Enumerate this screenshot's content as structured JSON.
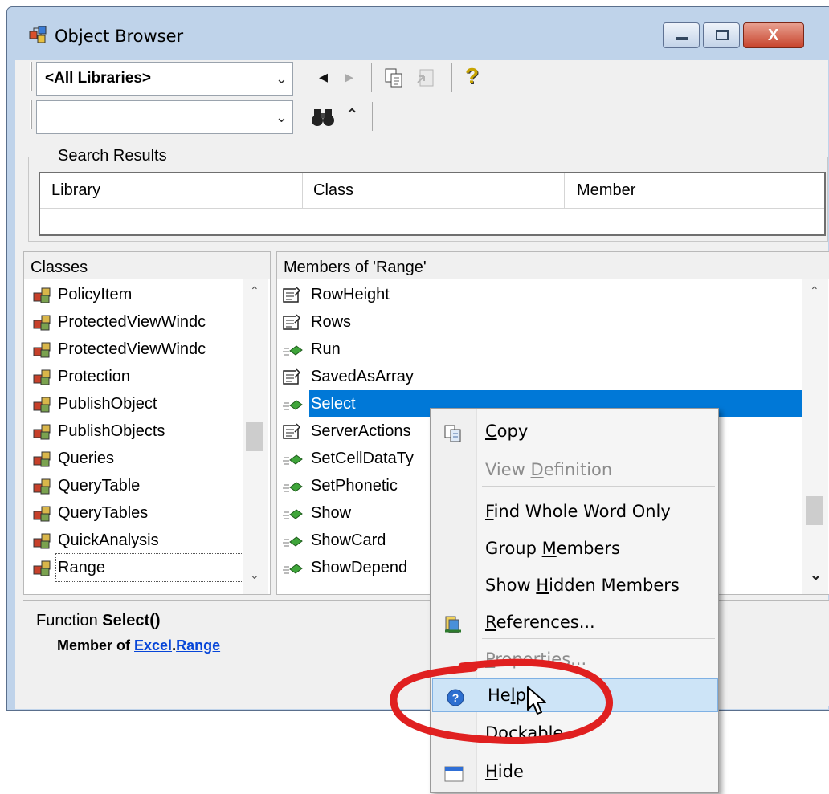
{
  "window": {
    "title": "Object Browser",
    "minimize_label": "–",
    "maximize_label": "□",
    "close_label": "X"
  },
  "toolbar": {
    "library_combo": "<All Libraries>",
    "search_combo": "",
    "back_icon": "◂",
    "forward_icon": "▸",
    "copy_icon": "copy-icon",
    "view_def_icon": "view-definition-icon",
    "help_glyph": "?",
    "search_icon": "binoculars-icon",
    "toggle_glyph": "⌃"
  },
  "search_results": {
    "group_label": "Search Results",
    "columns": [
      "Library",
      "Class",
      "Member"
    ]
  },
  "classes": {
    "header": "Classes",
    "items": [
      "PolicyItem",
      "ProtectedViewWindc",
      "ProtectedViewWindc",
      "Protection",
      "PublishObject",
      "PublishObjects",
      "Queries",
      "QueryTable",
      "QueryTables",
      "QuickAnalysis",
      "Range"
    ]
  },
  "members": {
    "header": "Members of 'Range'",
    "items": [
      {
        "label": "RowHeight",
        "kind": "property"
      },
      {
        "label": "Rows",
        "kind": "property"
      },
      {
        "label": "Run",
        "kind": "method"
      },
      {
        "label": "SavedAsArray",
        "kind": "property"
      },
      {
        "label": "Select",
        "kind": "method",
        "selected": true
      },
      {
        "label": "ServerActions",
        "kind": "property"
      },
      {
        "label": "SetCellDataTy",
        "kind": "method"
      },
      {
        "label": "SetPhonetic",
        "kind": "method"
      },
      {
        "label": "Show",
        "kind": "method"
      },
      {
        "label": "ShowCard",
        "kind": "method"
      },
      {
        "label": "ShowDepend",
        "kind": "method"
      }
    ]
  },
  "details": {
    "kind": "Function ",
    "name": "Select()",
    "member_of_prefix": "Member of ",
    "library_link": "Excel",
    "dot": ".",
    "class_link": "Range"
  },
  "context_menu": {
    "items": [
      {
        "label": "Copy",
        "mnemonic": "C",
        "disabled": false
      },
      {
        "label": "View Definition",
        "mnemonic": "D",
        "disabled": true
      },
      {
        "label": "Find Whole Word Only",
        "mnemonic": "F",
        "disabled": false
      },
      {
        "label": "Group Members",
        "mnemonic": "M",
        "disabled": false
      },
      {
        "label": "Show Hidden Members",
        "mnemonic": "H",
        "disabled": false
      },
      {
        "label": "References...",
        "mnemonic": "R",
        "disabled": false
      },
      {
        "label": "Properties...",
        "mnemonic": "P",
        "disabled": true
      },
      {
        "label": "Help",
        "mnemonic": "l",
        "disabled": false,
        "highlighted": true
      },
      {
        "label": "Dockable",
        "mnemonic": "k",
        "disabled": false
      },
      {
        "label": "Hide",
        "mnemonic": "H",
        "disabled": false
      }
    ]
  },
  "colors": {
    "selection": "#0078d7",
    "annotation": "#e02020",
    "link": "#0645d8"
  }
}
